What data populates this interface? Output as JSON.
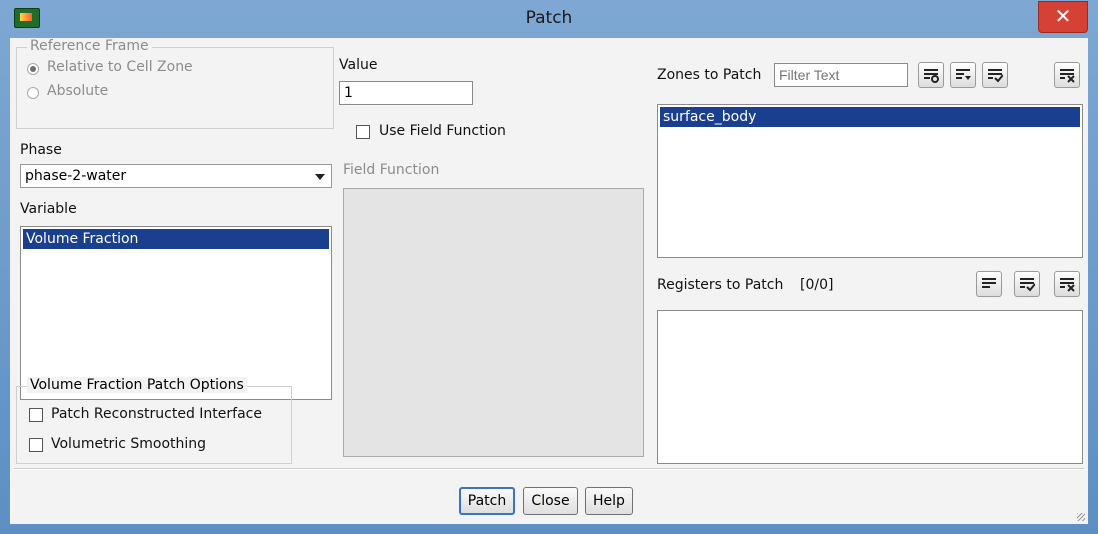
{
  "window": {
    "title": "Patch",
    "close_glyph": "✕"
  },
  "reference_frame": {
    "legend": "Reference Frame",
    "options": [
      {
        "label": "Relative to Cell Zone",
        "selected": true
      },
      {
        "label": "Absolute",
        "selected": false
      }
    ]
  },
  "phase": {
    "label": "Phase",
    "selected": "phase-2-water"
  },
  "variable": {
    "label": "Variable",
    "items": [
      "Volume Fraction"
    ]
  },
  "vf_options": {
    "legend": "Volume Fraction Patch Options",
    "items": [
      {
        "label": "Patch Reconstructed Interface",
        "checked": false
      },
      {
        "label": "Volumetric Smoothing",
        "checked": false
      }
    ]
  },
  "value": {
    "label": "Value",
    "current": "1"
  },
  "use_field_function": {
    "label": "Use Field Function",
    "checked": false
  },
  "field_function": {
    "label": "Field Function"
  },
  "zones": {
    "label": "Zones to Patch",
    "filter_placeholder": "Filter Text",
    "items": [
      "surface_body"
    ],
    "tool_icons": [
      "match-icon",
      "select-all-icon",
      "deselect-all-icon",
      "clear-icon"
    ]
  },
  "registers": {
    "label": "Registers to Patch",
    "count": "[0/0]",
    "items": [],
    "tool_icons": [
      "select-all-icon",
      "deselect-all-icon",
      "clear-icon"
    ]
  },
  "buttons": {
    "patch": "Patch",
    "close": "Close",
    "help": "Help"
  },
  "colors": {
    "selection": "#1b3f8f",
    "close_button": "#d64136",
    "title_bar": "#6f9bc8"
  }
}
